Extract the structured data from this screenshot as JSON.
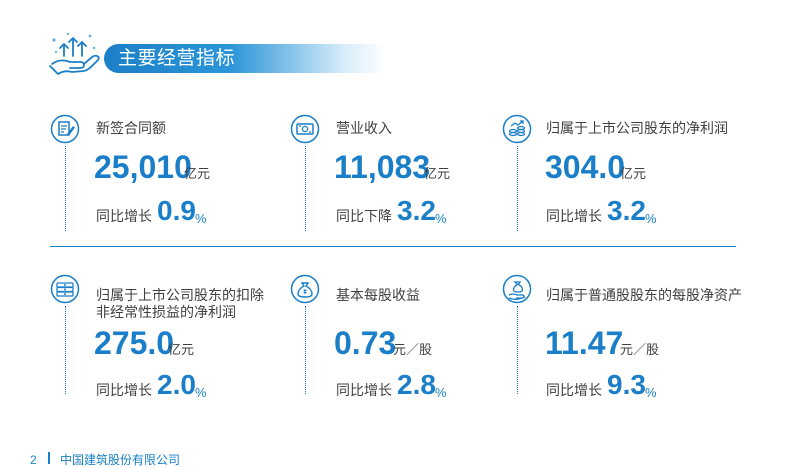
{
  "header": {
    "title": "主要经营指标"
  },
  "metrics": [
    {
      "label": "新签合同额",
      "value": "25,010",
      "unit": "亿元",
      "change_label": "同比增长",
      "change_value": "0.9",
      "percent_sign": "%"
    },
    {
      "label": "营业收入",
      "value": "11,083",
      "unit": "亿元",
      "change_label": "同比下降",
      "change_value": "3.2",
      "percent_sign": "%"
    },
    {
      "label": "归属于上市公司股东的净利润",
      "value": "304.0",
      "unit": "亿元",
      "change_label": "同比增长",
      "change_value": "3.2",
      "percent_sign": "%"
    },
    {
      "label_line1": "归属于上市公司股东的扣除",
      "label_line2": "非经常性损益的净利润",
      "value": "275.0",
      "unit": "亿元",
      "change_label": "同比增长",
      "change_value": "2.0",
      "percent_sign": "%"
    },
    {
      "label": "基本每股收益",
      "value": "0.73",
      "unit": "元／股",
      "change_label": "同比增长",
      "change_value": "2.8",
      "percent_sign": "%"
    },
    {
      "label": "归属于普通股股东的每股净资产",
      "value": "11.47",
      "unit": "元／股",
      "change_label": "同比增长",
      "change_value": "9.3",
      "percent_sign": "%"
    }
  ],
  "icons": {
    "header": "hand-growth-arrows-icon",
    "m0": "contract-signing-icon",
    "m1": "cash-bill-icon",
    "m2": "coins-growth-icon",
    "m3": "money-stack-icon",
    "m4": "money-bag-icon",
    "m5": "money-bag-hand-icon"
  },
  "footer": {
    "page": "2",
    "company": "中国建筑股份有限公司"
  },
  "colors": {
    "accent": "#1a7fc8"
  }
}
